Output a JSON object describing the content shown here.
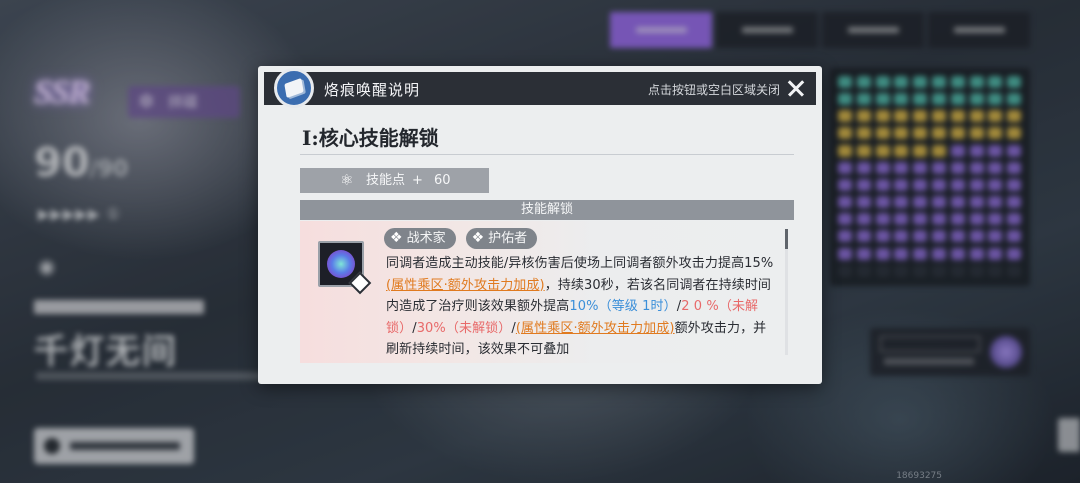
{
  "background": {
    "rarity": "SSR",
    "class_label": "拝碟",
    "level_current": "90",
    "level_max": "/90",
    "stars": "▶▶▶▶▶ ①",
    "character_name": "千灯无间",
    "footer_id": "18693275"
  },
  "modal": {
    "title": "烙痕唤醒说明",
    "close_hint": "点击按钮或空白区域关闭",
    "section_title": "I:核心技能解锁",
    "skill_points": {
      "label": "技能点",
      "plus": "+",
      "value": "60"
    },
    "unlock_header": "技能解锁",
    "skill": {
      "tags": [
        "战术家",
        "护佑者"
      ],
      "desc": {
        "p1": "同调者造成主动技能/异核伤害后使场上同调者额外攻击力提高15%",
        "link1": "(属性乘区·额外攻击力加成)",
        "p2": "，持续30秒，若该名同调者在持续时间内造成了治疗则该效果额外提高",
        "v1": "10%（等级 1时）",
        "sep1": "/",
        "v2": "2 0 %（未解锁）",
        "sep2": "/",
        "v3": "30%（未解锁）",
        "sep3": "/",
        "link2": "(属性乘区·额外攻击力加成)",
        "p3": "额外攻击力，并刷新持续时间，该效果不可叠加"
      }
    }
  },
  "colors": {
    "accent_purple": "#9b6df0",
    "link_orange": "#e07a1f",
    "value_blue": "#3b8fd9",
    "locked_red": "#e86a6a"
  },
  "icons": {
    "header": "book-icon",
    "close": "close-icon",
    "points": "atom-icon",
    "tag": "diamond-tag-icon",
    "skill": "skill-glyph-icon"
  }
}
